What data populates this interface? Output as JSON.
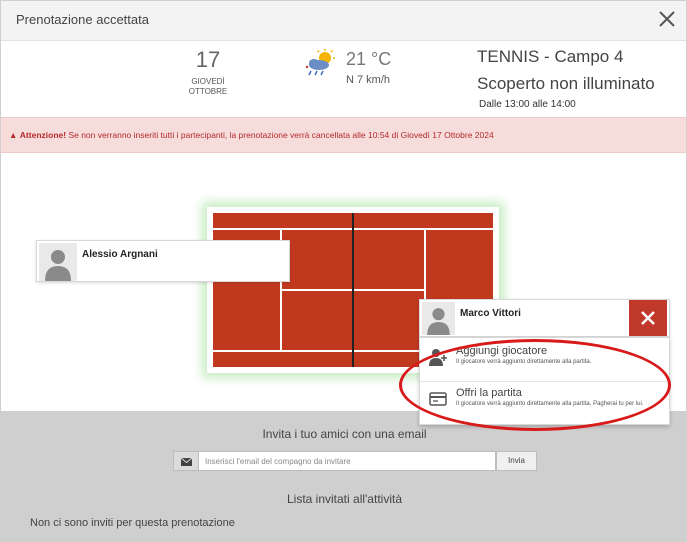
{
  "header": {
    "title": "Prenotazione accettata",
    "close_icon": "close-icon"
  },
  "booking": {
    "date_number": "17",
    "weekday": "GIOVEDÌ",
    "month": "OTTOBRE",
    "weather_icon": "partly-cloudy-rain-icon",
    "temperature": "21 °C",
    "wind": "N 7 km/h",
    "sport": "TENNIS - Campo 4",
    "court_type": "Scoperto non illuminato",
    "time_range": "Dalle 13:00 alle 14:00"
  },
  "warning": {
    "label": "Attenzione!",
    "icon": "warning-icon",
    "message": " Se non verranno inseriti tutti i partecipanti, la prenotazione verrà cancellata alle 10:54 di Giovedì 17 Ottobre 2024"
  },
  "players": [
    {
      "name": "Alessio Argnani"
    },
    {
      "name": "Marco Vittori"
    }
  ],
  "menu": {
    "items": [
      {
        "title": "Aggiungi giocatore",
        "subtitle": "Il giocatore verrà aggiunto direttamente alla partita.",
        "icon": "add-user-icon"
      },
      {
        "title": "Offri la partita",
        "subtitle": "Il giocatore verrà aggiunto direttamente alla partita. Pagherai tu per lui.",
        "icon": "credit-card-icon"
      }
    ]
  },
  "invite": {
    "title": "Invita i tuo amici con una email",
    "placeholder": "Inserisci l'email del compagno da invitare",
    "send_label": "Invia",
    "list_title": "Lista invitati all'attività",
    "empty_message": "Non ci sono inviti per questa prenotazione"
  },
  "colors": {
    "court": "#c0391f",
    "remove_button": "#c0392b",
    "warning_bg": "#f7dcdc",
    "warning_text": "#b32b2b",
    "highlight_ellipse": "#d81a1a"
  }
}
